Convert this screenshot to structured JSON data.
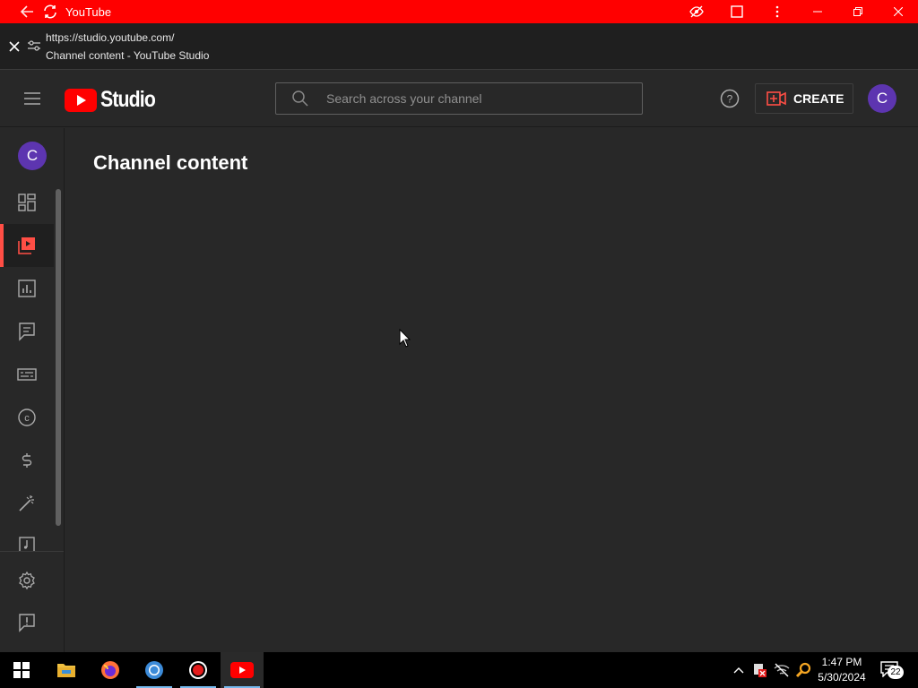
{
  "titlebar": {
    "app_title": "YouTube"
  },
  "urlbar": {
    "url": "https://studio.youtube.com/",
    "page_title": "Channel content - YouTube Studio"
  },
  "header": {
    "logo_text": "Studio",
    "search_placeholder": "Search across your channel",
    "create_label": "CREATE",
    "avatar_letter": "C"
  },
  "sidebar": {
    "avatar_letter": "C",
    "items": [
      {
        "name": "dashboard",
        "icon": "dashboard-icon"
      },
      {
        "name": "content",
        "icon": "content-icon",
        "active": true
      },
      {
        "name": "analytics",
        "icon": "analytics-icon"
      },
      {
        "name": "comments",
        "icon": "comments-icon"
      },
      {
        "name": "subtitles",
        "icon": "subtitles-icon"
      },
      {
        "name": "copyright",
        "icon": "copyright-icon"
      },
      {
        "name": "earn",
        "icon": "dollar-icon"
      },
      {
        "name": "customization",
        "icon": "magic-wand-icon"
      },
      {
        "name": "audio-library",
        "icon": "music-icon"
      }
    ],
    "bottom_items": [
      {
        "name": "settings",
        "icon": "gear-icon"
      },
      {
        "name": "send-feedback",
        "icon": "feedback-icon"
      }
    ]
  },
  "main": {
    "heading": "Channel content"
  },
  "taskbar": {
    "apps": [
      "file-explorer-icon",
      "firefox-icon",
      "chrome-icon",
      "recorder-icon",
      "youtube-icon"
    ],
    "time": "1:47 PM",
    "date": "5/30/2024",
    "notification_count": "22"
  },
  "colors": {
    "brand_red": "#ff0000",
    "active_accent": "#ff4e45",
    "avatar_purple": "#5d35b0",
    "background": "#282828"
  }
}
